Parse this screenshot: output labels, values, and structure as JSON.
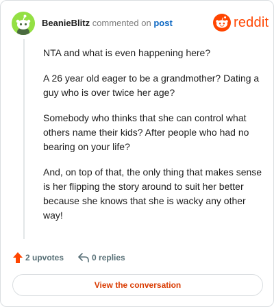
{
  "header": {
    "username": "BeanieBlitz",
    "commented_on_text": "commented on",
    "post_link_text": "post",
    "brand_name": "reddit"
  },
  "comment": {
    "paragraphs": [
      "NTA and what is even happening here?",
      "A 26 year old eager to be a grandmother? Dating a guy who is over twice her age?",
      "Somebody who thinks that she can control what others name their kids? After people who had no bearing on your life?",
      "And, on top of that, the only thing that makes sense is her flipping the story around to suit her better because she knows that she is wacky any other way!"
    ]
  },
  "actions": {
    "upvotes_label": "2 upvotes",
    "replies_label": "0 replies"
  },
  "cta": {
    "label": "View the conversation"
  },
  "colors": {
    "brand": "#ff4500",
    "avatar_bg": "#94e044",
    "link": "#0a66c2",
    "cta_text": "#d93a00"
  },
  "icons": [
    "reddit-snoo-avatar-icon",
    "reddit-logo-icon",
    "upvote-arrow-icon",
    "reply-arrow-icon"
  ]
}
